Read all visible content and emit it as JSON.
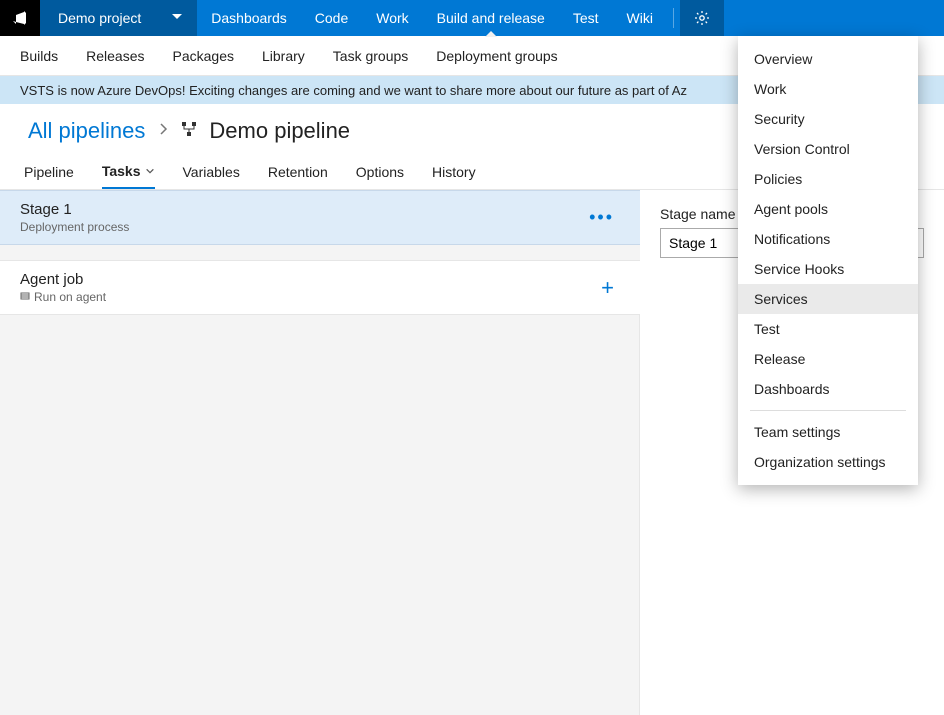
{
  "topnav": {
    "project": "Demo project",
    "items": [
      "Dashboards",
      "Code",
      "Work",
      "Build and release",
      "Test",
      "Wiki"
    ],
    "active_index": 3
  },
  "subnav": {
    "items": [
      "Builds",
      "Releases",
      "Packages",
      "Library",
      "Task groups",
      "Deployment groups"
    ]
  },
  "banner": "VSTS is now Azure DevOps! Exciting changes are coming and we want to share more about our future as part of Az",
  "breadcrumb": {
    "all": "All pipelines",
    "title": "Demo pipeline"
  },
  "tabs": {
    "items": [
      "Pipeline",
      "Tasks",
      "Variables",
      "Retention",
      "Options",
      "History"
    ],
    "active_index": 1
  },
  "stage": {
    "name": "Stage 1",
    "sub": "Deployment process"
  },
  "job": {
    "name": "Agent job",
    "sub": "Run on agent"
  },
  "rightpane": {
    "label": "Stage name",
    "value": "Stage 1"
  },
  "settings_menu": {
    "group1": [
      "Overview",
      "Work",
      "Security",
      "Version Control",
      "Policies",
      "Agent pools",
      "Notifications",
      "Service Hooks",
      "Services",
      "Test",
      "Release",
      "Dashboards"
    ],
    "group2": [
      "Team settings",
      "Organization settings"
    ],
    "highlight": "Services"
  }
}
